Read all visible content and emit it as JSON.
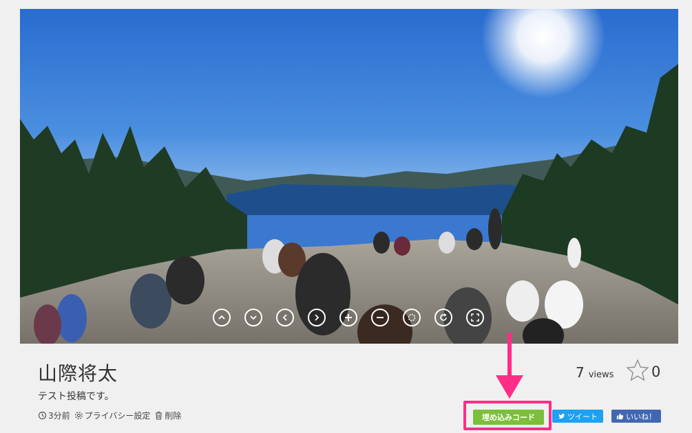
{
  "viewer": {
    "controls": [
      {
        "name": "tilt-up-icon"
      },
      {
        "name": "tilt-down-icon"
      },
      {
        "name": "pan-left-icon"
      },
      {
        "name": "pan-right-icon"
      },
      {
        "name": "zoom-in-icon"
      },
      {
        "name": "zoom-out-icon"
      },
      {
        "name": "auto-rotate-icon"
      },
      {
        "name": "reset-view-icon"
      },
      {
        "name": "fullscreen-icon"
      }
    ]
  },
  "post": {
    "author": "山際将太",
    "caption": "テスト投稿です。",
    "time_ago": "3分前",
    "privacy_label": "プライバシー設定",
    "delete_label": "削除"
  },
  "stats": {
    "views_count": "7",
    "views_unit": "views",
    "favorites_count": "0"
  },
  "actions": {
    "embed_label": "埋め込みコード",
    "tweet_label": "ツイート",
    "like_label": "いいね！"
  },
  "colors": {
    "embed_button": "#7bbf3a",
    "highlight": "#ff2d85",
    "tweet_button": "#1da1f2",
    "like_button": "#4267b2"
  }
}
